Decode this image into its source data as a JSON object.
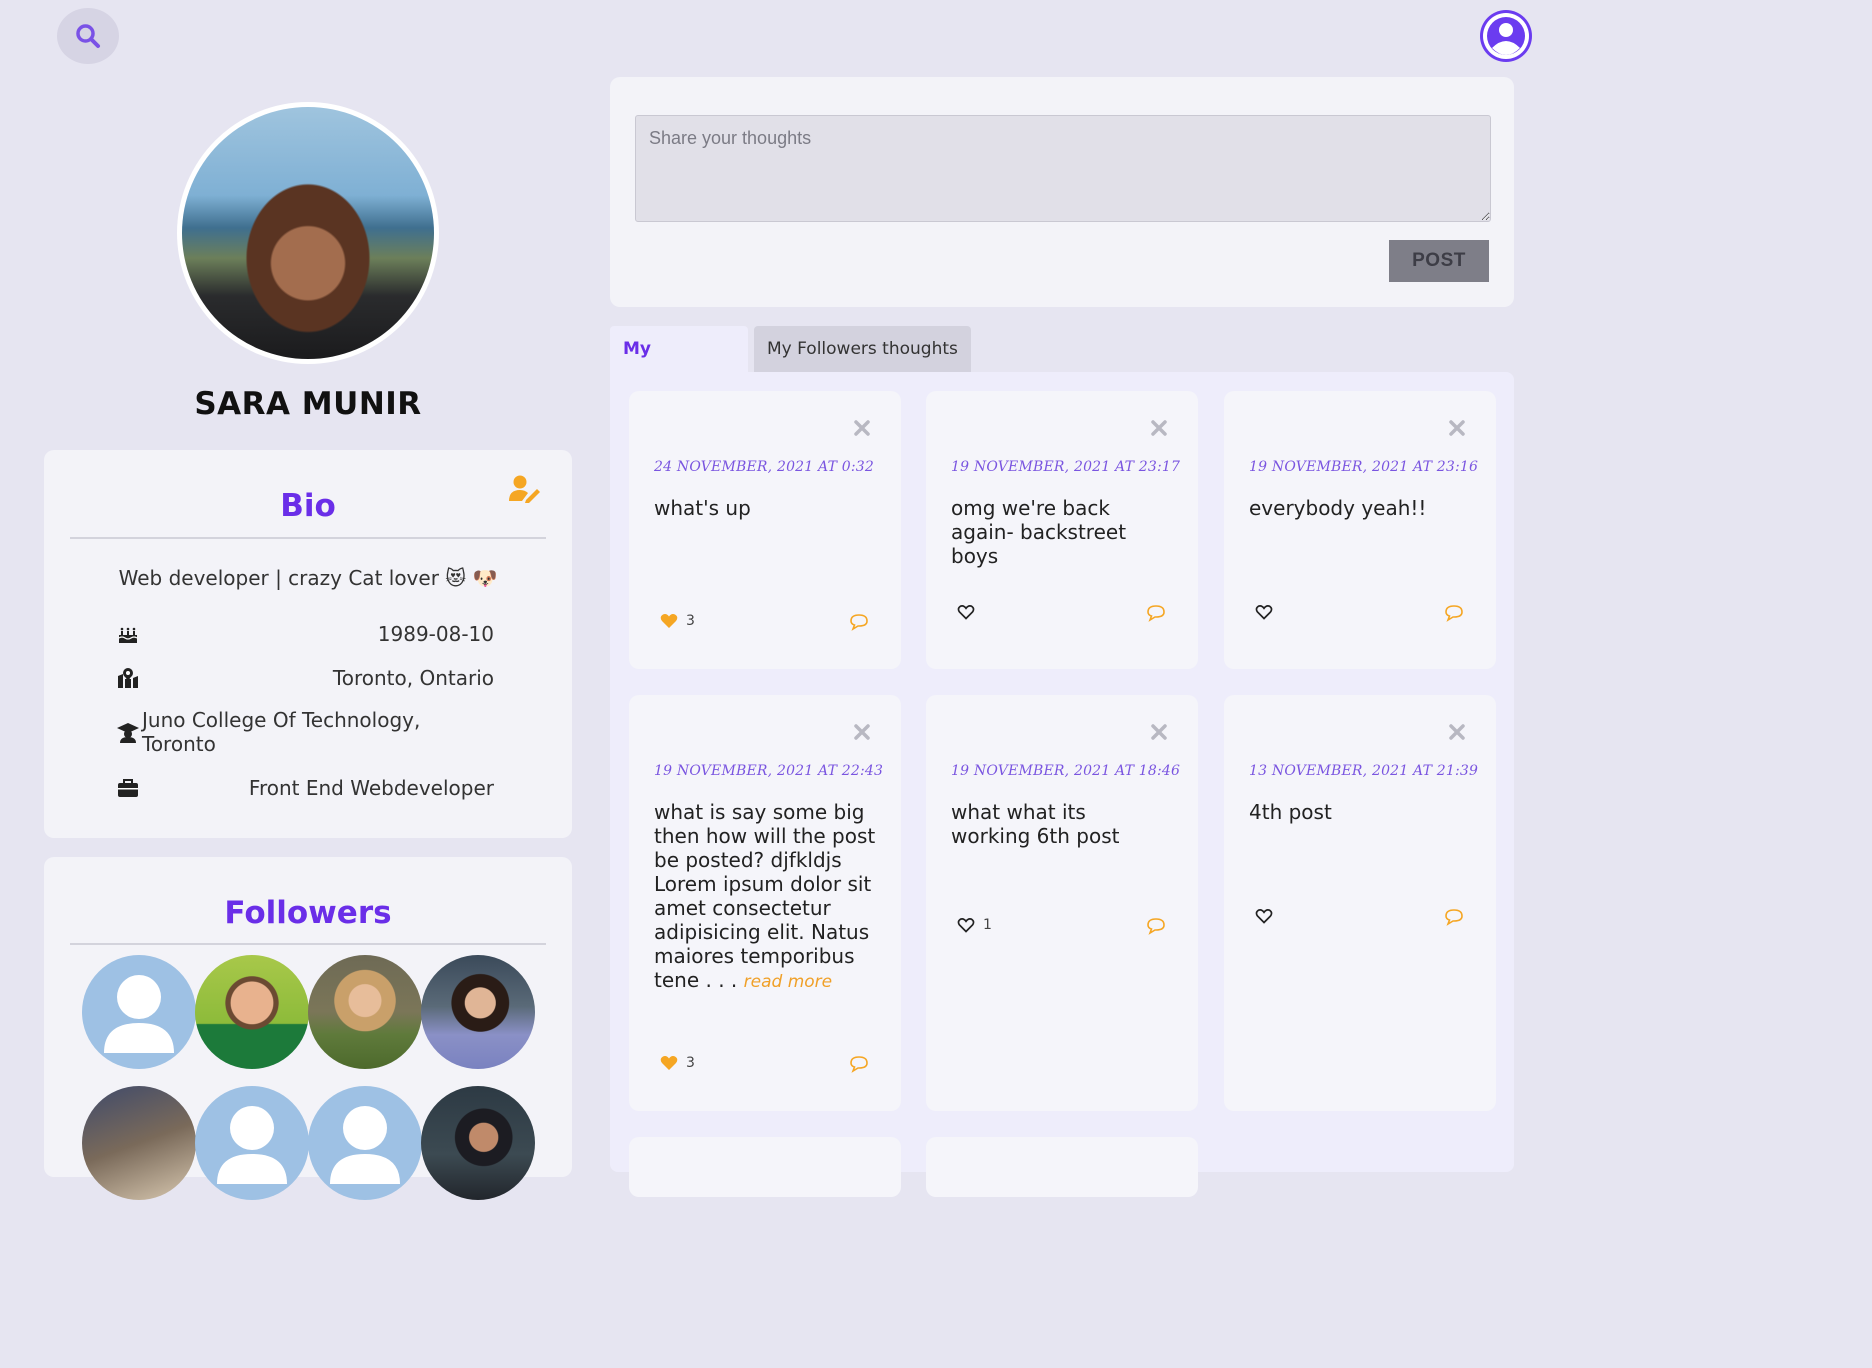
{
  "header": {
    "search_icon": "search-icon",
    "user_icon": "user-circle-icon"
  },
  "profile": {
    "name": "SARA MUNIR",
    "bio": {
      "title": "Bio",
      "text": "Web developer | crazy Cat lover 😻 🐶",
      "birthday": "1989-08-10",
      "location": "Toronto, Ontario",
      "education": "Juno College Of Technology, Toronto",
      "occupation": "Front End Webdeveloper"
    },
    "followers": {
      "title": "Followers"
    }
  },
  "compose": {
    "placeholder": "Share your thoughts",
    "post_label": "POST"
  },
  "tabs": [
    {
      "label": "My Thoughts"
    },
    {
      "label": "My Followers thoughts"
    }
  ],
  "colors": {
    "accent": "#6a2ee8",
    "like": "#f5a623",
    "background": "#e6e5f1"
  },
  "posts": [
    {
      "date": "24 NOVEMBER, 2021 AT 0:32",
      "text": "what's up",
      "likes": "3",
      "liked": true
    },
    {
      "date": "19 NOVEMBER, 2021 AT 23:17",
      "text": "omg we're back again- backstreet boys",
      "likes": "",
      "liked": false
    },
    {
      "date": "19 NOVEMBER, 2021 AT 23:16",
      "text": "everybody yeah!!",
      "likes": "",
      "liked": false
    },
    {
      "date": "19 NOVEMBER, 2021 AT 22:43",
      "text": "what is say some big then how will the post be posted? djfkldjs Lorem ipsum dolor sit amet consectetur adipisicing elit. Natus maiores temporibus tene . . .",
      "read_more": "read more",
      "likes": "3",
      "liked": true
    },
    {
      "date": "19 NOVEMBER, 2021 AT 18:46",
      "text": "what what its working 6th post",
      "likes": "1",
      "liked": false
    },
    {
      "date": "13 NOVEMBER, 2021 AT 21:39",
      "text": "4th post",
      "likes": "",
      "liked": false
    }
  ]
}
